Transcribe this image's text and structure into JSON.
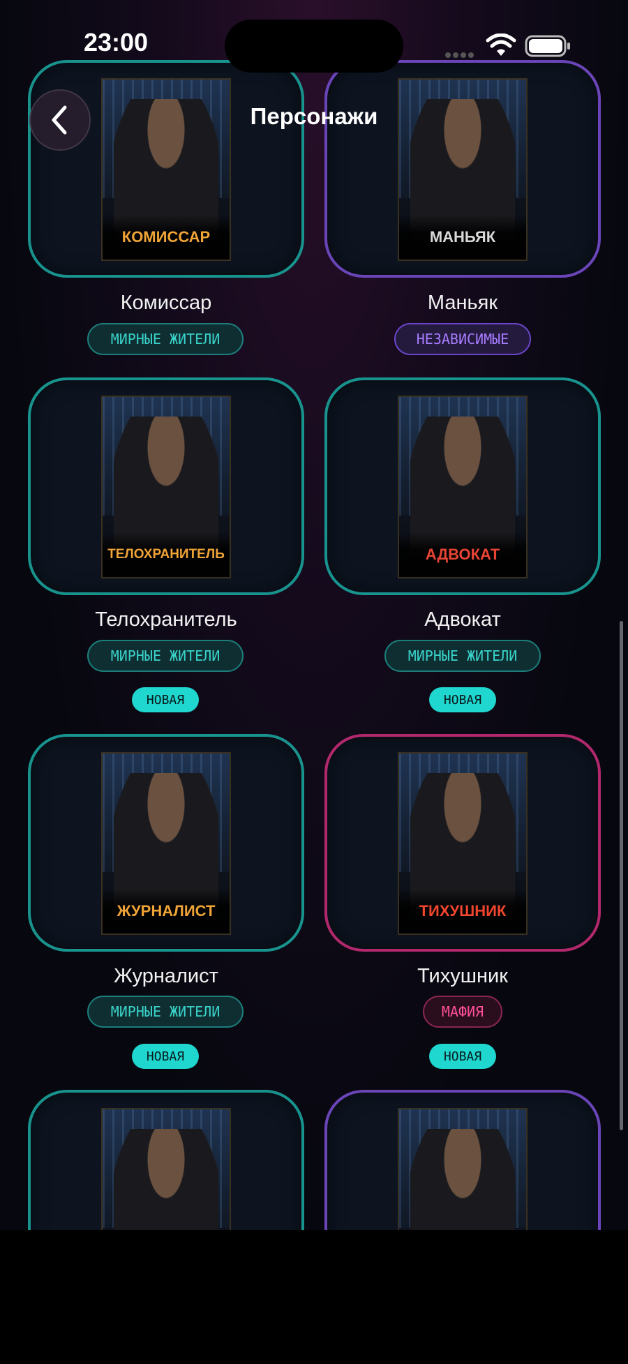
{
  "status_bar": {
    "time": "23:00"
  },
  "header": {
    "title": "Персонажи"
  },
  "colors": {
    "town": "#1fa7a0",
    "independent": "#6a45b8",
    "mafia": "#b1286c",
    "new_badge": "#1fd7cf"
  },
  "characters": [
    {
      "name": "Комиссар",
      "poster_label": "КОМИССАР",
      "team": "МИРНЫЕ ЖИТЕЛИ",
      "team_type": "town",
      "label_color": "#f0a437",
      "is_new": false
    },
    {
      "name": "Маньяк",
      "poster_label": "МАНЬЯК",
      "team": "НЕЗАВИСИМЫЕ",
      "team_type": "indep",
      "label_color": "#d9d9d9",
      "is_new": false
    },
    {
      "name": "Телохранитель",
      "poster_label": "ТЕЛОХРАНИТЕЛЬ",
      "team": "МИРНЫЕ ЖИТЕЛИ",
      "team_type": "town",
      "label_color": "#f0a437",
      "is_new": true,
      "new_label": "НОВАЯ"
    },
    {
      "name": "Адвокат",
      "poster_label": "АДВОКАТ",
      "team": "МИРНЫЕ ЖИТЕЛИ",
      "team_type": "town",
      "label_color": "#e84434",
      "is_new": true,
      "new_label": "НОВАЯ"
    },
    {
      "name": "Журналист",
      "poster_label": "ЖУРНАЛИСТ",
      "team": "МИРНЫЕ ЖИТЕЛИ",
      "team_type": "town",
      "label_color": "#f0a437",
      "is_new": true,
      "new_label": "НОВАЯ"
    },
    {
      "name": "Тихушник",
      "poster_label": "ТИХУШНИК",
      "team": "МАФИЯ",
      "team_type": "mafia",
      "label_color": "#f0452e",
      "is_new": true,
      "new_label": "НОВАЯ"
    },
    {
      "name": "",
      "poster_label": "",
      "team": "",
      "team_type": "town",
      "label_color": "#f0a437",
      "is_new": false
    },
    {
      "name": "",
      "poster_label": "",
      "team": "",
      "team_type": "indep",
      "label_color": "#d9d9d9",
      "is_new": false
    }
  ]
}
